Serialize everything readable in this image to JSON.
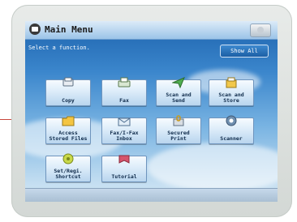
{
  "header": {
    "title": "Main Menu"
  },
  "prompt": "Select a function.",
  "show_all": "Show All",
  "functions": [
    {
      "label": "Copy",
      "icon": "copy-icon"
    },
    {
      "label": "Fax",
      "icon": "fax-icon"
    },
    {
      "label": "Scan and\nSend",
      "icon": "send-icon"
    },
    {
      "label": "Scan and\nStore",
      "icon": "store-icon"
    },
    {
      "label": "Access\nStored Files",
      "icon": "folder-icon"
    },
    {
      "label": "Fax/I-Fax\nInbox",
      "icon": "inbox-icon"
    },
    {
      "label": "Secured\nPrint",
      "icon": "lock-print-icon"
    },
    {
      "label": "Scanner",
      "icon": "scanner-icon"
    },
    {
      "label": "Set/Regi.\nShortcut",
      "icon": "star-icon"
    },
    {
      "label": "Tutorial",
      "icon": "tutorial-icon"
    }
  ]
}
